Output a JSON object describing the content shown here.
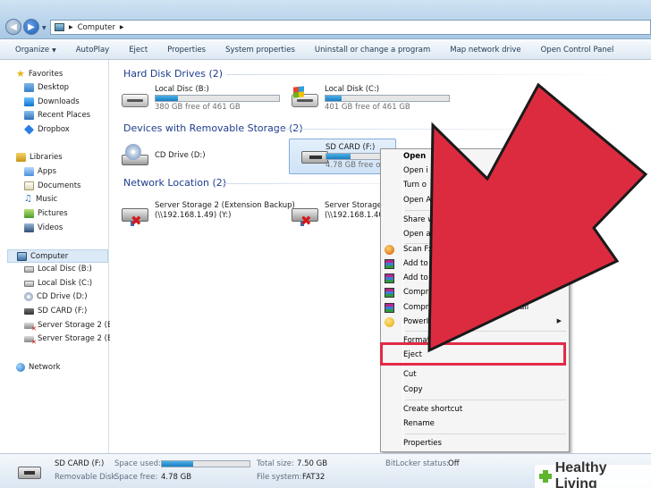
{
  "window": {
    "breadcrumb": "Computer"
  },
  "toolbar": {
    "items": [
      "Organize",
      "AutoPlay",
      "Eject",
      "Properties",
      "System properties",
      "Uninstall or change a program",
      "Map network drive",
      "Open Control Panel"
    ]
  },
  "nav": {
    "favorites": "Favorites",
    "favorites_items": [
      "Desktop",
      "Downloads",
      "Recent Places",
      "Dropbox"
    ],
    "libraries": "Libraries",
    "libraries_items": [
      "Apps",
      "Documents",
      "Music",
      "Pictures",
      "Videos"
    ],
    "computer": "Computer",
    "computer_items": [
      "Local Disc (B:)",
      "Local Disk (C:)",
      "CD Drive (D:)",
      "SD CARD (F:)",
      "Server Storage 2 (Ext",
      "Server Storage 2 (Ext"
    ],
    "network": "Network"
  },
  "content": {
    "hdd_header": "Hard Disk Drives (2)",
    "removable_header": "Devices with Removable Storage (2)",
    "network_header": "Network Location (2)",
    "drives": [
      {
        "name": "Local Disc (B:)",
        "free": "380 GB free of 461 GB",
        "used_fraction": 0.18
      },
      {
        "name": "Local Disk (C:)",
        "free": "401 GB free of 461 GB",
        "used_fraction": 0.13
      }
    ],
    "removable": [
      {
        "name": "CD Drive (D:)"
      },
      {
        "name": "SD CARD (F:)",
        "free": "4.78 GB free of",
        "used_fraction": 0.36
      }
    ],
    "network": [
      {
        "name": "Server Storage 2 (Extension Backup)",
        "path": "(\\\\192.168.1.49) (Y:)"
      },
      {
        "name": "Server Storage 2",
        "path": "(\\\\192.168.1.40)"
      }
    ]
  },
  "context_menu": {
    "items": [
      "Open",
      "Open i",
      "Turn o",
      "Open A",
      "Share w",
      "Open a",
      "Scan F:",
      "Add to",
      "Add to",
      "Compre",
      "Compre",
      "PowerIS",
      "Format",
      "Eject",
      "Cut",
      "Copy",
      "Create shortcut",
      "Rename",
      "Properties"
    ],
    "compre_suffix": "\" and email"
  },
  "details": {
    "name": "SD CARD (F:)",
    "type": "Removable Disk",
    "space_used_label": "Space used:",
    "space_used_fraction": 0.36,
    "space_free_label": "Space free:",
    "space_free": "4.78 GB",
    "total_size_label": "Total size:",
    "total_size": "7.50 GB",
    "fs_label": "File system:",
    "fs": "FAT32",
    "bitlocker_label": "BitLocker status:",
    "bitlocker": "Off"
  },
  "watermark": {
    "text": "Healthy Living"
  },
  "colors": {
    "accent": "#e22a45",
    "arrow": "#dc2b3f"
  }
}
